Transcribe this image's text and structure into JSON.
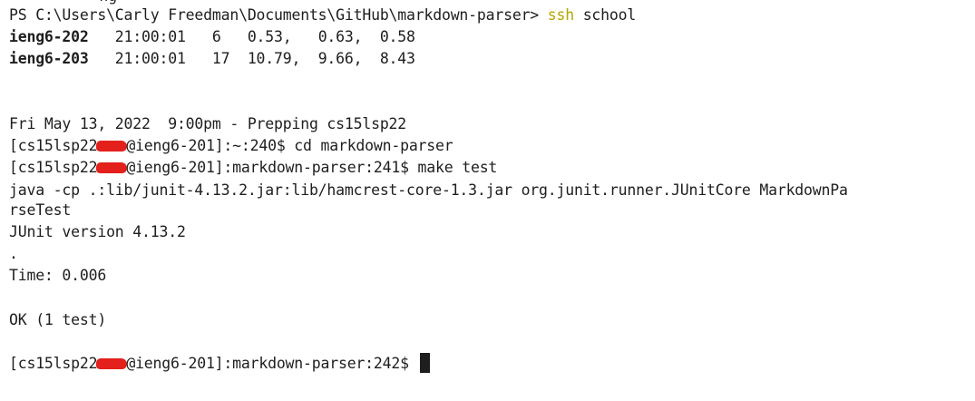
{
  "terminal": {
    "partial_top_line": "          ng",
    "prompt_ps": "PS C:\\Users\\Carly Freedman\\Documents\\GitHub\\markdown-parser> ",
    "ssh_cmd": "ssh",
    "ssh_arg": " school",
    "host_rows": [
      {
        "host": "ieng6-202",
        "rest": "   21:00:01   6   0.53,   0.63,  0.58"
      },
      {
        "host": "ieng6-203",
        "rest": "   21:00:01   17  10.79,  9.66,  8.43"
      }
    ],
    "motd": "Fri May 13, 2022  9:00pm - Prepping cs15lsp22",
    "user_prefix": "[cs15lsp22",
    "line_cd_suffix": "@ieng6-201]:~:240$ cd markdown-parser",
    "line_make_suffix": "@ieng6-201]:markdown-parser:241$ make test",
    "java_line_1": "java -cp .:lib/junit-4.13.2.jar:lib/hamcrest-core-1.3.jar org.junit.runner.JUnitCore MarkdownPa",
    "java_line_2": "rseTest",
    "junit_version": "JUnit version 4.13.2",
    "dot": ".",
    "time": "Time: 0.006",
    "ok": "OK (1 test)",
    "final_prompt_suffix": "@ieng6-201]:markdown-parser:242$ "
  }
}
